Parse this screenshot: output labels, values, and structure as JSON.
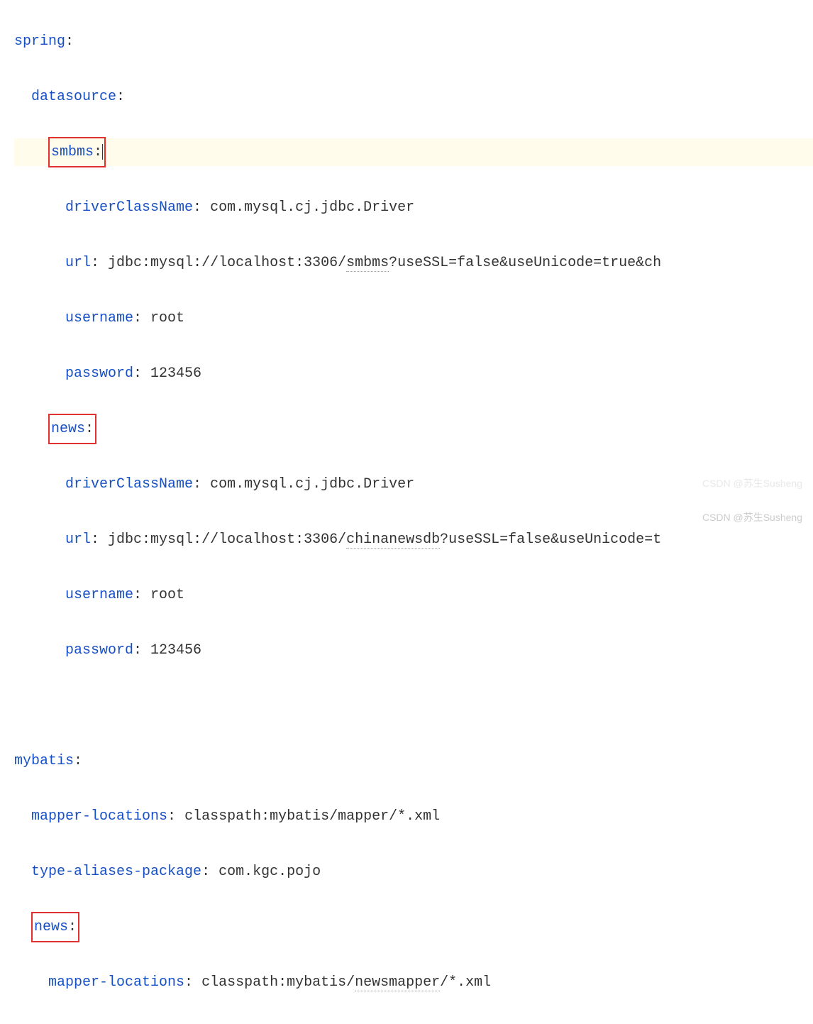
{
  "code": {
    "line1": {
      "key": "spring",
      "colon": ":"
    },
    "line2": {
      "key": "datasource",
      "colon": ":"
    },
    "line3": {
      "key": "smbms",
      "colon": ":"
    },
    "line4": {
      "key": "driverClassName",
      "colon": ": ",
      "value": "com.mysql.cj.jdbc.Driver"
    },
    "line5": {
      "key": "url",
      "colon": ": ",
      "value_prefix": "jdbc:mysql://localhost:3306/",
      "value_underlined": "smbms",
      "value_suffix": "?useSSL=false&useUnicode=true&ch"
    },
    "line6": {
      "key": "username",
      "colon": ": ",
      "value": "root"
    },
    "line7": {
      "key": "password",
      "colon": ": ",
      "value": "123456"
    },
    "line8": {
      "key": "news",
      "colon": ":"
    },
    "line9": {
      "key": "driverClassName",
      "colon": ": ",
      "value": "com.mysql.cj.jdbc.Driver"
    },
    "line10": {
      "key": "url",
      "colon": ": ",
      "value_prefix": "jdbc:mysql://localhost:3306/",
      "value_underlined": "chinanewsdb",
      "value_suffix": "?useSSL=false&useUnicode=t"
    },
    "line11": {
      "key": "username",
      "colon": ": ",
      "value": "root"
    },
    "line12": {
      "key": "password",
      "colon": ": ",
      "value": "123456"
    },
    "line13": {
      "key": "mybatis",
      "colon": ":"
    },
    "line14": {
      "key": "mapper-locations",
      "colon": ": ",
      "value": "classpath:mybatis/mapper/*.xml"
    },
    "line15": {
      "key": "type-aliases-package",
      "colon": ": ",
      "value": "com.kgc.pojo"
    },
    "line16": {
      "key": "news",
      "colon": ":"
    },
    "line17": {
      "key": "mapper-locations",
      "colon": ": ",
      "value_prefix": "classpath:mybatis/",
      "value_underlined": "newsmapper",
      "value_suffix": "/*.xml"
    }
  },
  "watermark": "CSDN @苏生Susheng",
  "watermark2": "CSDN @苏生Susheng"
}
